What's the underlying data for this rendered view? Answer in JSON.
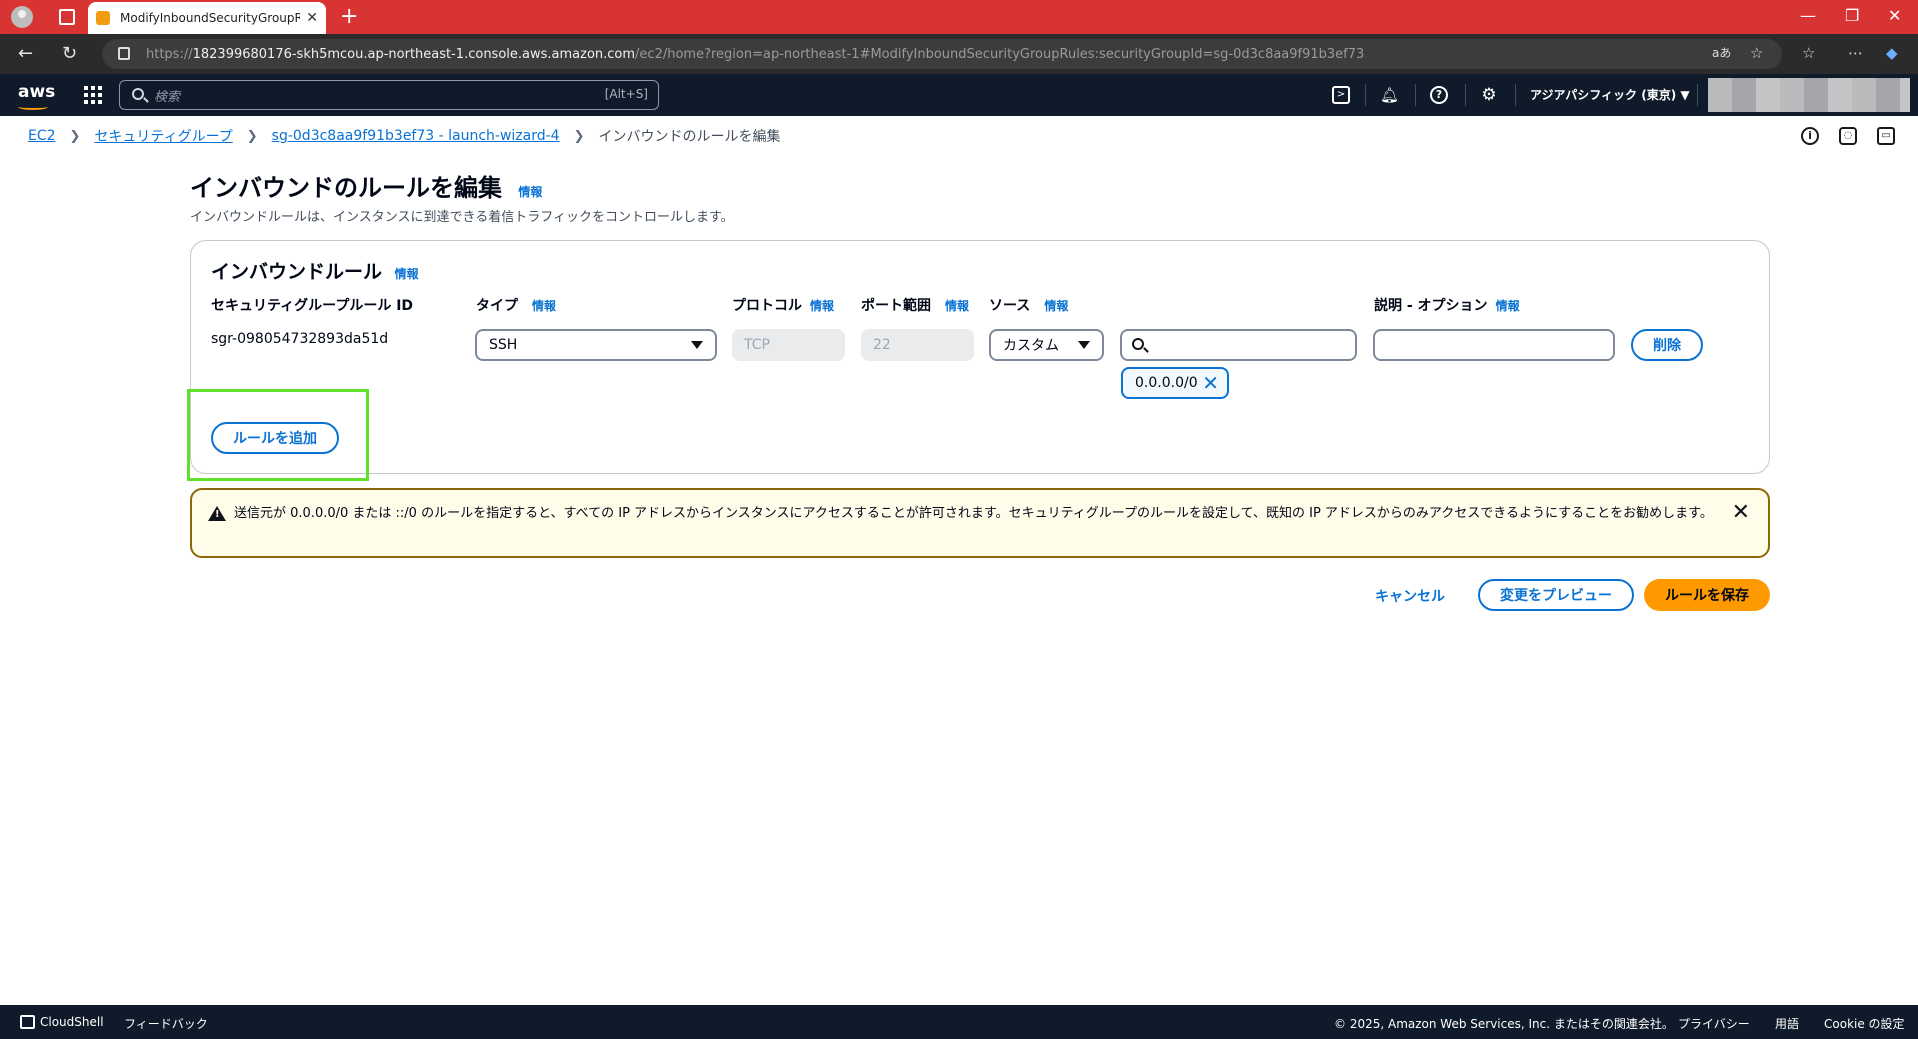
{
  "browser": {
    "tab_title": "ModifyInboundSecurityGroupRules",
    "url_prefix": "https://",
    "url_host": "182399680176-skh5mcou.ap-northeast-1.console.aws.amazon.com",
    "url_path": "/ec2/home?region=ap-northeast-1#ModifyInboundSecurityGroupRules:securityGroupId=sg-0d3c8aa9f91b3ef73",
    "reader_label": "aあ"
  },
  "aws_header": {
    "logo": "aws",
    "search_placeholder": "検索",
    "search_shortcut": "[Alt+S]",
    "region": "アジアパシフィック (東京) ▼"
  },
  "breadcrumb": {
    "items": [
      "EC2",
      "セキュリティグループ",
      "sg-0d3c8aa9f91b3ef73 - launch-wizard-4"
    ],
    "current": "インバウンドのルールを編集"
  },
  "page": {
    "title": "インバウンドのルールを編集",
    "info": "情報",
    "description": "インバウンドルールは、インスタンスに到達できる着信トラフィックをコントロールします。"
  },
  "panel": {
    "title": "インバウンドルール",
    "info": "情報",
    "columns": {
      "rule_id": "セキュリティグループルール ID",
      "type": "タイプ",
      "protocol": "プロトコル",
      "port_range": "ポート範囲",
      "source": "ソース",
      "description": "説明 - オプション"
    },
    "rule": {
      "id": "sgr-098054732893da51d",
      "type": "SSH",
      "protocol": "TCP",
      "port": "22",
      "source_type": "カスタム",
      "source_search": "",
      "source_token": "0.0.0.0/0",
      "description": ""
    },
    "delete_label": "削除",
    "add_rule_label": "ルールを追加"
  },
  "alert": {
    "text": "送信元が 0.0.0.0/0 または ::/0 のルールを指定すると、すべての IP アドレスからインスタンスにアクセスすることが許可されます。セキュリティグループのルールを設定して、既知の IP アドレスからのみアクセスできるようにすることをお勧めします。"
  },
  "actions": {
    "cancel": "キャンセル",
    "preview": "変更をプレビュー",
    "save": "ルールを保存"
  },
  "footer": {
    "cloudshell": "CloudShell",
    "feedback": "フィードバック",
    "copyright": "© 2025, Amazon Web Services, Inc. またはその関連会社。",
    "privacy": "プライバシー",
    "terms": "用語",
    "cookie": "Cookie の設定"
  },
  "colors": {
    "accent": "#0972d3",
    "primary": "#ff9900",
    "tabbar": "#d93434",
    "header": "#0f1b2a",
    "highlight": "#5ee02c"
  }
}
